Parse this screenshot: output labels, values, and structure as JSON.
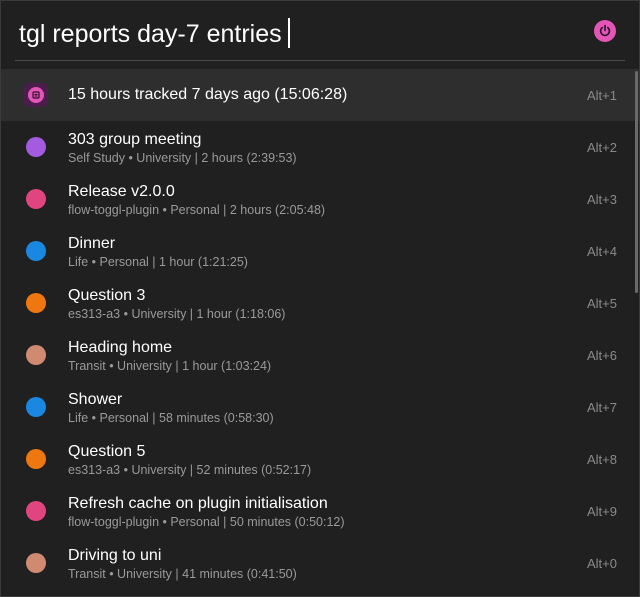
{
  "search": {
    "query": "tgl reports day-7 entries"
  },
  "plugin": {
    "icon": "power-icon",
    "color": "#e455b8"
  },
  "results": [
    {
      "title": "15 hours tracked 7 days ago (15:06:28)",
      "subtitle": "",
      "hotkey": "Alt+1",
      "color": "#e455b8",
      "icon": "toggl-app-icon",
      "selected": true
    },
    {
      "title": "303 group meeting",
      "subtitle": "Self Study • University | 2 hours (2:39:53)",
      "hotkey": "Alt+2",
      "color": "#a35ce0"
    },
    {
      "title": "Release v2.0.0",
      "subtitle": "flow-toggl-plugin • Personal | 2 hours (2:05:48)",
      "hotkey": "Alt+3",
      "color": "#e0457f"
    },
    {
      "title": "Dinner",
      "subtitle": "Life • Personal | 1 hour (1:21:25)",
      "hotkey": "Alt+4",
      "color": "#1a88e0"
    },
    {
      "title": "Question 3",
      "subtitle": "es313-a3 • University | 1 hour (1:18:06)",
      "hotkey": "Alt+5",
      "color": "#ef7710"
    },
    {
      "title": "Heading home",
      "subtitle": "Transit • University | 1 hour (1:03:24)",
      "hotkey": "Alt+6",
      "color": "#d08a72"
    },
    {
      "title": "Shower",
      "subtitle": "Life • Personal | 58 minutes (0:58:30)",
      "hotkey": "Alt+7",
      "color": "#1a88e0"
    },
    {
      "title": "Question 5",
      "subtitle": "es313-a3 • University | 52 minutes (0:52:17)",
      "hotkey": "Alt+8",
      "color": "#ef7710"
    },
    {
      "title": "Refresh cache on plugin initialisation",
      "subtitle": "flow-toggl-plugin • Personal | 50 minutes (0:50:12)",
      "hotkey": "Alt+9",
      "color": "#e0457f"
    },
    {
      "title": "Driving to uni",
      "subtitle": "Transit • University | 41 minutes (0:41:50)",
      "hotkey": "Alt+0",
      "color": "#d08a72"
    }
  ]
}
